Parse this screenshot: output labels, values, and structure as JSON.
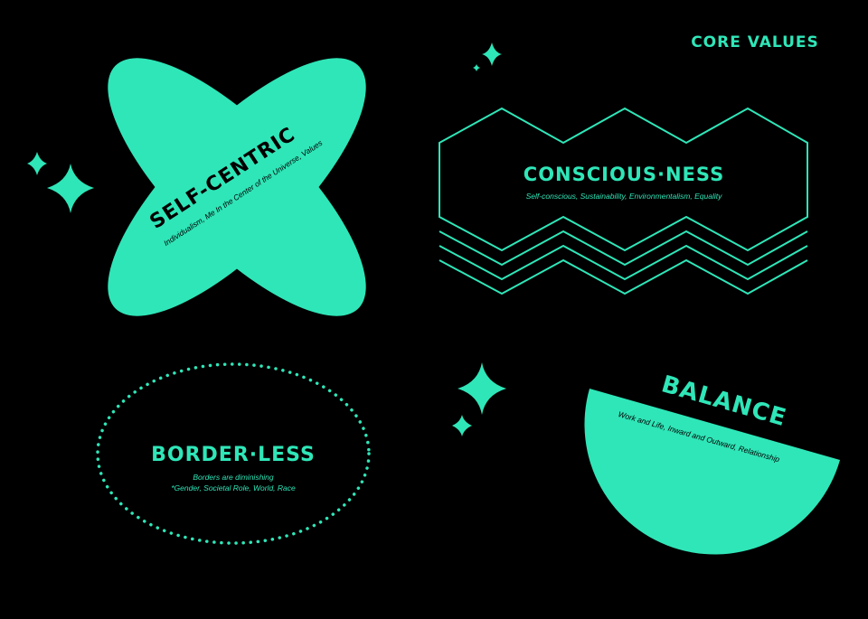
{
  "header": {
    "title": "CORE VALUES"
  },
  "colors": {
    "accent": "#2fe6b8",
    "background": "#000000"
  },
  "values": {
    "self_centric": {
      "title": "SELF-CENTRIC",
      "subtitle": "Individualism, Me In the Center of the Universe, Values"
    },
    "consciousness": {
      "title": "CONSCIOUS·NESS",
      "subtitle": "Self-conscious, Sustainability, Environmentalism, Equality"
    },
    "borderless": {
      "title": "BORDER·LESS",
      "subtitle_line1": "Borders are diminishing",
      "subtitle_line2": "*Gender, Societal Role, World, Race"
    },
    "balance": {
      "title": "BALANCE",
      "subtitle": "Work and Life, Inward and Outward, Relationship"
    }
  },
  "icons": [
    "sparkle-icon",
    "x-shape-icon",
    "zigzag-icon",
    "dotted-ellipse-icon",
    "semicircle-icon"
  ]
}
